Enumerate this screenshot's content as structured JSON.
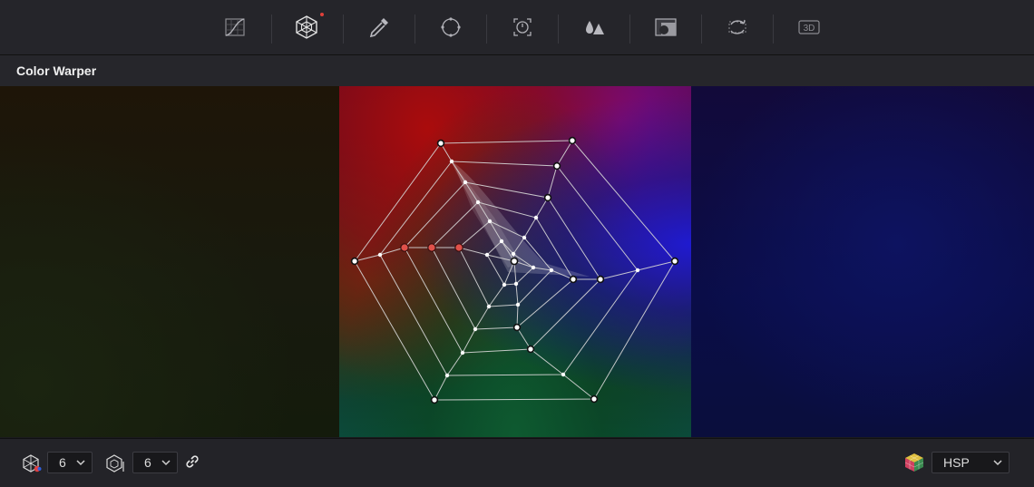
{
  "toolbar": {
    "tools": [
      {
        "icon": "curves-icon",
        "active": false
      },
      {
        "icon": "color-warper-icon",
        "active": true
      },
      {
        "icon": "qualifier-eyedropper-icon",
        "active": false
      },
      {
        "icon": "power-window-icon",
        "active": false
      },
      {
        "icon": "tracker-icon",
        "active": false
      },
      {
        "icon": "blur-icon",
        "active": false
      },
      {
        "icon": "key-icon",
        "active": false
      },
      {
        "icon": "sizing-icon",
        "active": false
      },
      {
        "icon": "3d-icon",
        "active": false
      }
    ],
    "three_d_label": "3D"
  },
  "panel": {
    "title": "Color Warper"
  },
  "controls": {
    "hue_points": "6",
    "saturation_points": "6",
    "color_space": "HSP"
  },
  "colors": {
    "selected_point": "#e0514a",
    "mesh_line": "#d8d8d8",
    "active_indicator": "#e0403a"
  }
}
